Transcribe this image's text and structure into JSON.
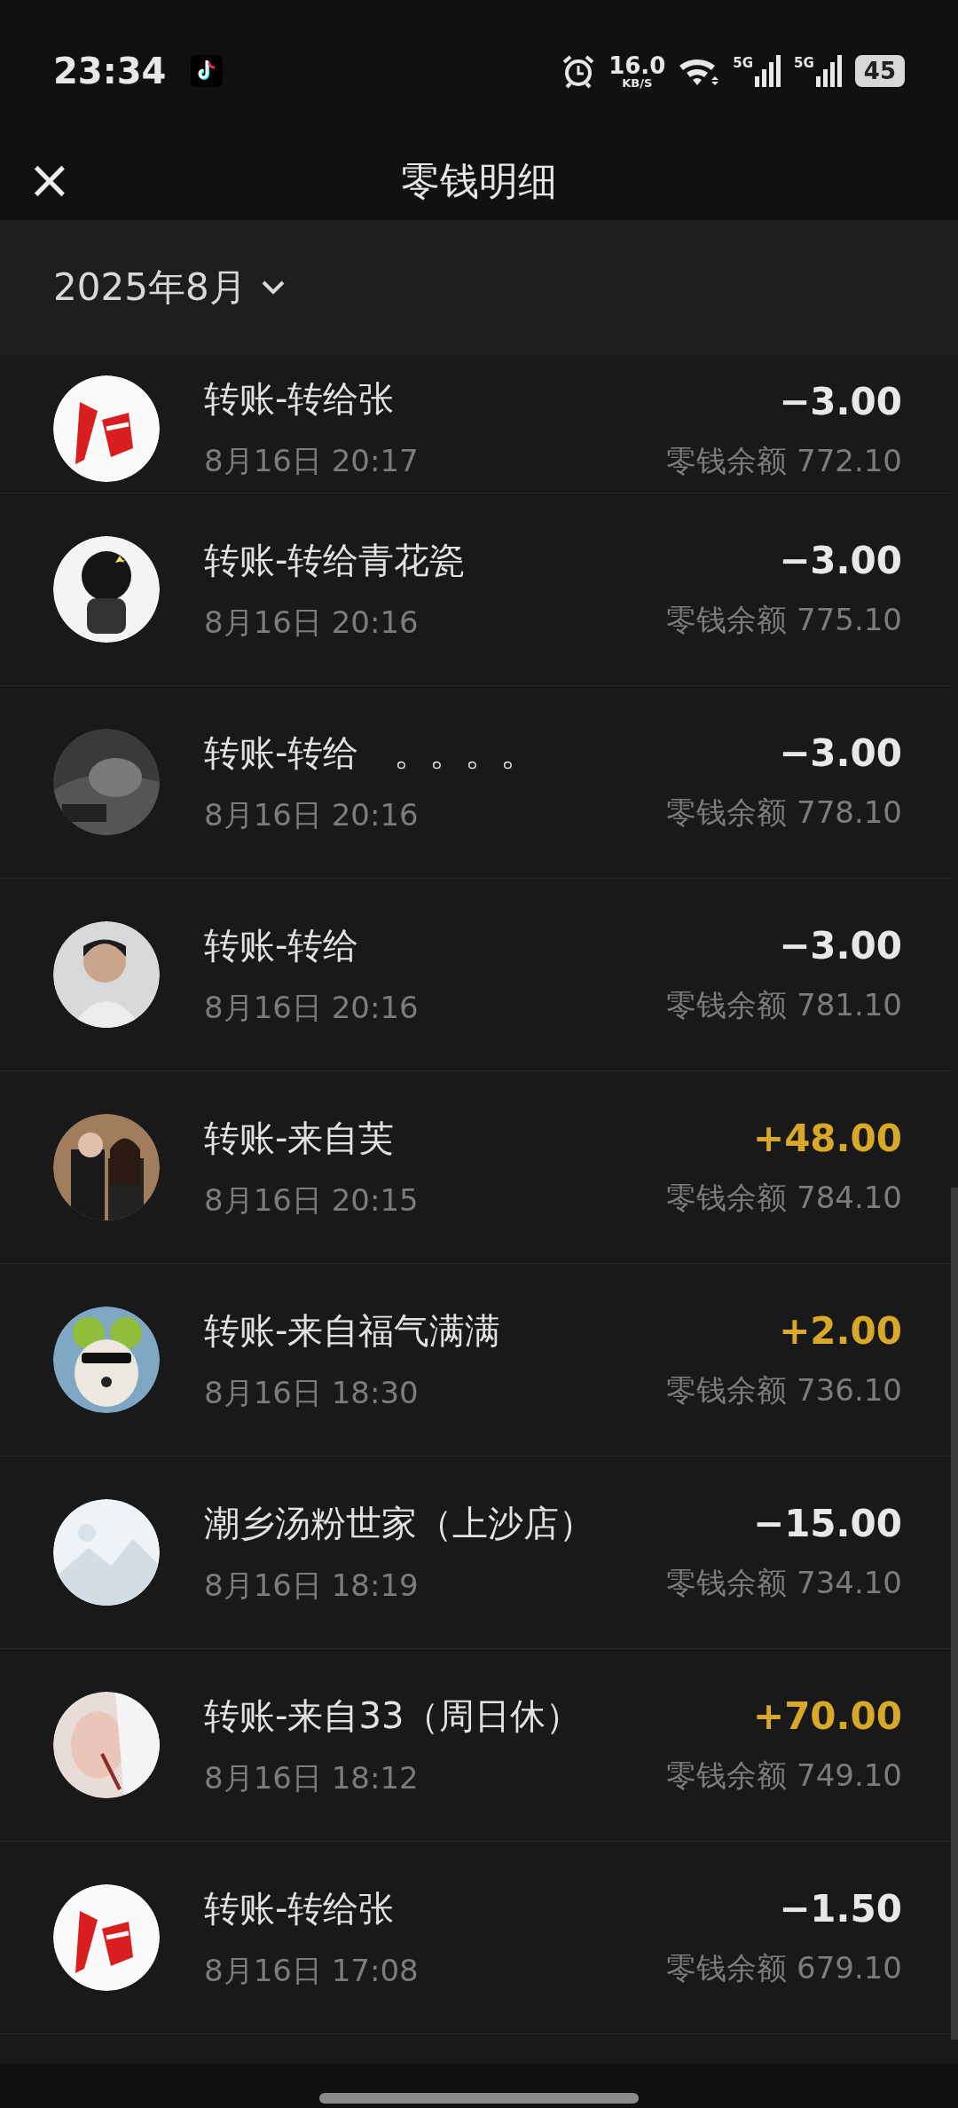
{
  "status_bar": {
    "time": "23:34",
    "speed": "16.0",
    "speed_unit": "KB/S",
    "network_1": "5G",
    "network_2": "5G",
    "battery": "45"
  },
  "header": {
    "close": "×",
    "title": "零钱明细"
  },
  "month_filter": {
    "label": "2025年8月"
  },
  "transactions": [
    {
      "title": "转账-转给张",
      "time": "8月16日 20:17",
      "amount": "−3.00",
      "kind": "expense",
      "balance": "零钱余额 772.10"
    },
    {
      "title": "转账-转给青花瓷",
      "time": "8月16日 20:16",
      "amount": "−3.00",
      "kind": "expense",
      "balance": "零钱余额 775.10"
    },
    {
      "title": "转账-转给　。。。。",
      "time": "8月16日 20:16",
      "amount": "−3.00",
      "kind": "expense",
      "balance": "零钱余额 778.10"
    },
    {
      "title": "转账-转给",
      "time": "8月16日 20:16",
      "amount": "−3.00",
      "kind": "expense",
      "balance": "零钱余额 781.10"
    },
    {
      "title": "转账-来自芙",
      "time": "8月16日 20:15",
      "amount": "+48.00",
      "kind": "income",
      "balance": "零钱余额 784.10"
    },
    {
      "title": "转账-来自福气满满",
      "time": "8月16日 18:30",
      "amount": "+2.00",
      "kind": "income",
      "balance": "零钱余额 736.10"
    },
    {
      "title": "潮乡汤粉世家（上沙店）",
      "time": "8月16日 18:19",
      "amount": "−15.00",
      "kind": "expense",
      "balance": "零钱余额 734.10"
    },
    {
      "title": "转账-来自33（周日休）",
      "time": "8月16日 18:12",
      "amount": "+70.00",
      "kind": "income",
      "balance": "零钱余额 749.10"
    },
    {
      "title": "转账-转给张",
      "time": "8月16日 17:08",
      "amount": "−1.50",
      "kind": "expense",
      "balance": "零钱余额 679.10"
    }
  ]
}
